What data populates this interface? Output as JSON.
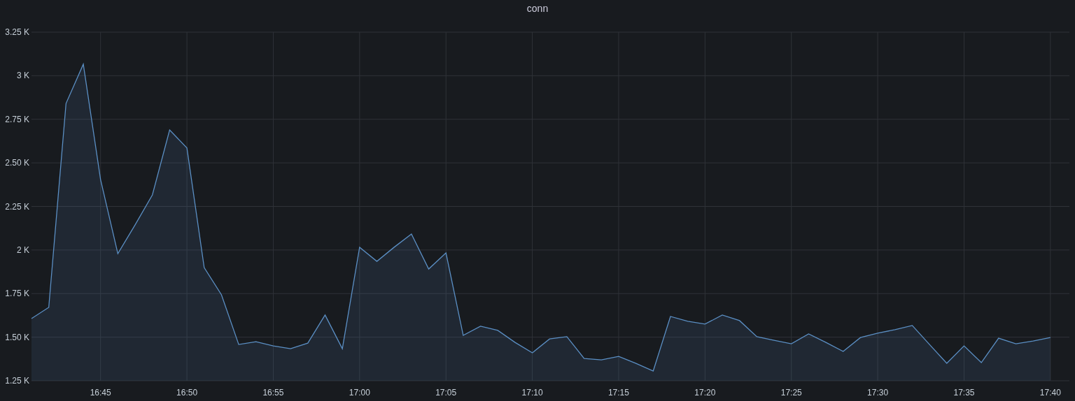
{
  "panel": {
    "chart_data": {
      "type": "area",
      "title": "conn",
      "grid": true,
      "categories": [
        null,
        null,
        null,
        null,
        "16:45",
        null,
        null,
        null,
        null,
        "16:50",
        null,
        null,
        null,
        null,
        "16:55",
        null,
        null,
        null,
        null,
        "17:00",
        null,
        null,
        null,
        null,
        "17:05",
        null,
        null,
        null,
        null,
        "17:10",
        null,
        null,
        null,
        null,
        "17:15",
        null,
        null,
        null,
        null,
        "17:20",
        null,
        null,
        null,
        null,
        "17:25",
        null,
        null,
        null,
        null,
        "17:30",
        null,
        null,
        null,
        null,
        "17:35",
        null,
        null,
        null,
        null,
        "17:40"
      ],
      "series": [
        {
          "color": "#5b8fc4",
          "values": [
            1607,
            1671,
            2841,
            3066,
            2404,
            1979,
            2144,
            2316,
            2689,
            2585,
            1899,
            1743,
            1458,
            1474,
            1450,
            1434,
            1466,
            1627,
            1434,
            2016,
            1935,
            2016,
            2092,
            1891,
            1983,
            1510,
            1563,
            1539,
            1470,
            1410,
            1490,
            1503,
            1378,
            1370,
            1390,
            1350,
            1306,
            1619,
            1591,
            1575,
            1627,
            1595,
            1503,
            1482,
            1462,
            1519,
            1470,
            1418,
            1498,
            1523,
            1543,
            1567,
            1458,
            1350,
            1450,
            1354,
            1494,
            1462,
            1478,
            1498
          ]
        }
      ],
      "ylim": [
        1250,
        3250
      ],
      "yticks": [
        {
          "value": 1250,
          "label": "1.25 K"
        },
        {
          "value": 1500,
          "label": "1.50 K"
        },
        {
          "value": 1750,
          "label": "1.75 K"
        },
        {
          "value": 2000,
          "label": "2 K"
        },
        {
          "value": 2250,
          "label": "2.25 K"
        },
        {
          "value": 2500,
          "label": "2.50 K"
        },
        {
          "value": 2750,
          "label": "2.75 K"
        },
        {
          "value": 3000,
          "label": "3 K"
        },
        {
          "value": 3250,
          "label": "3.25 K"
        }
      ]
    }
  }
}
